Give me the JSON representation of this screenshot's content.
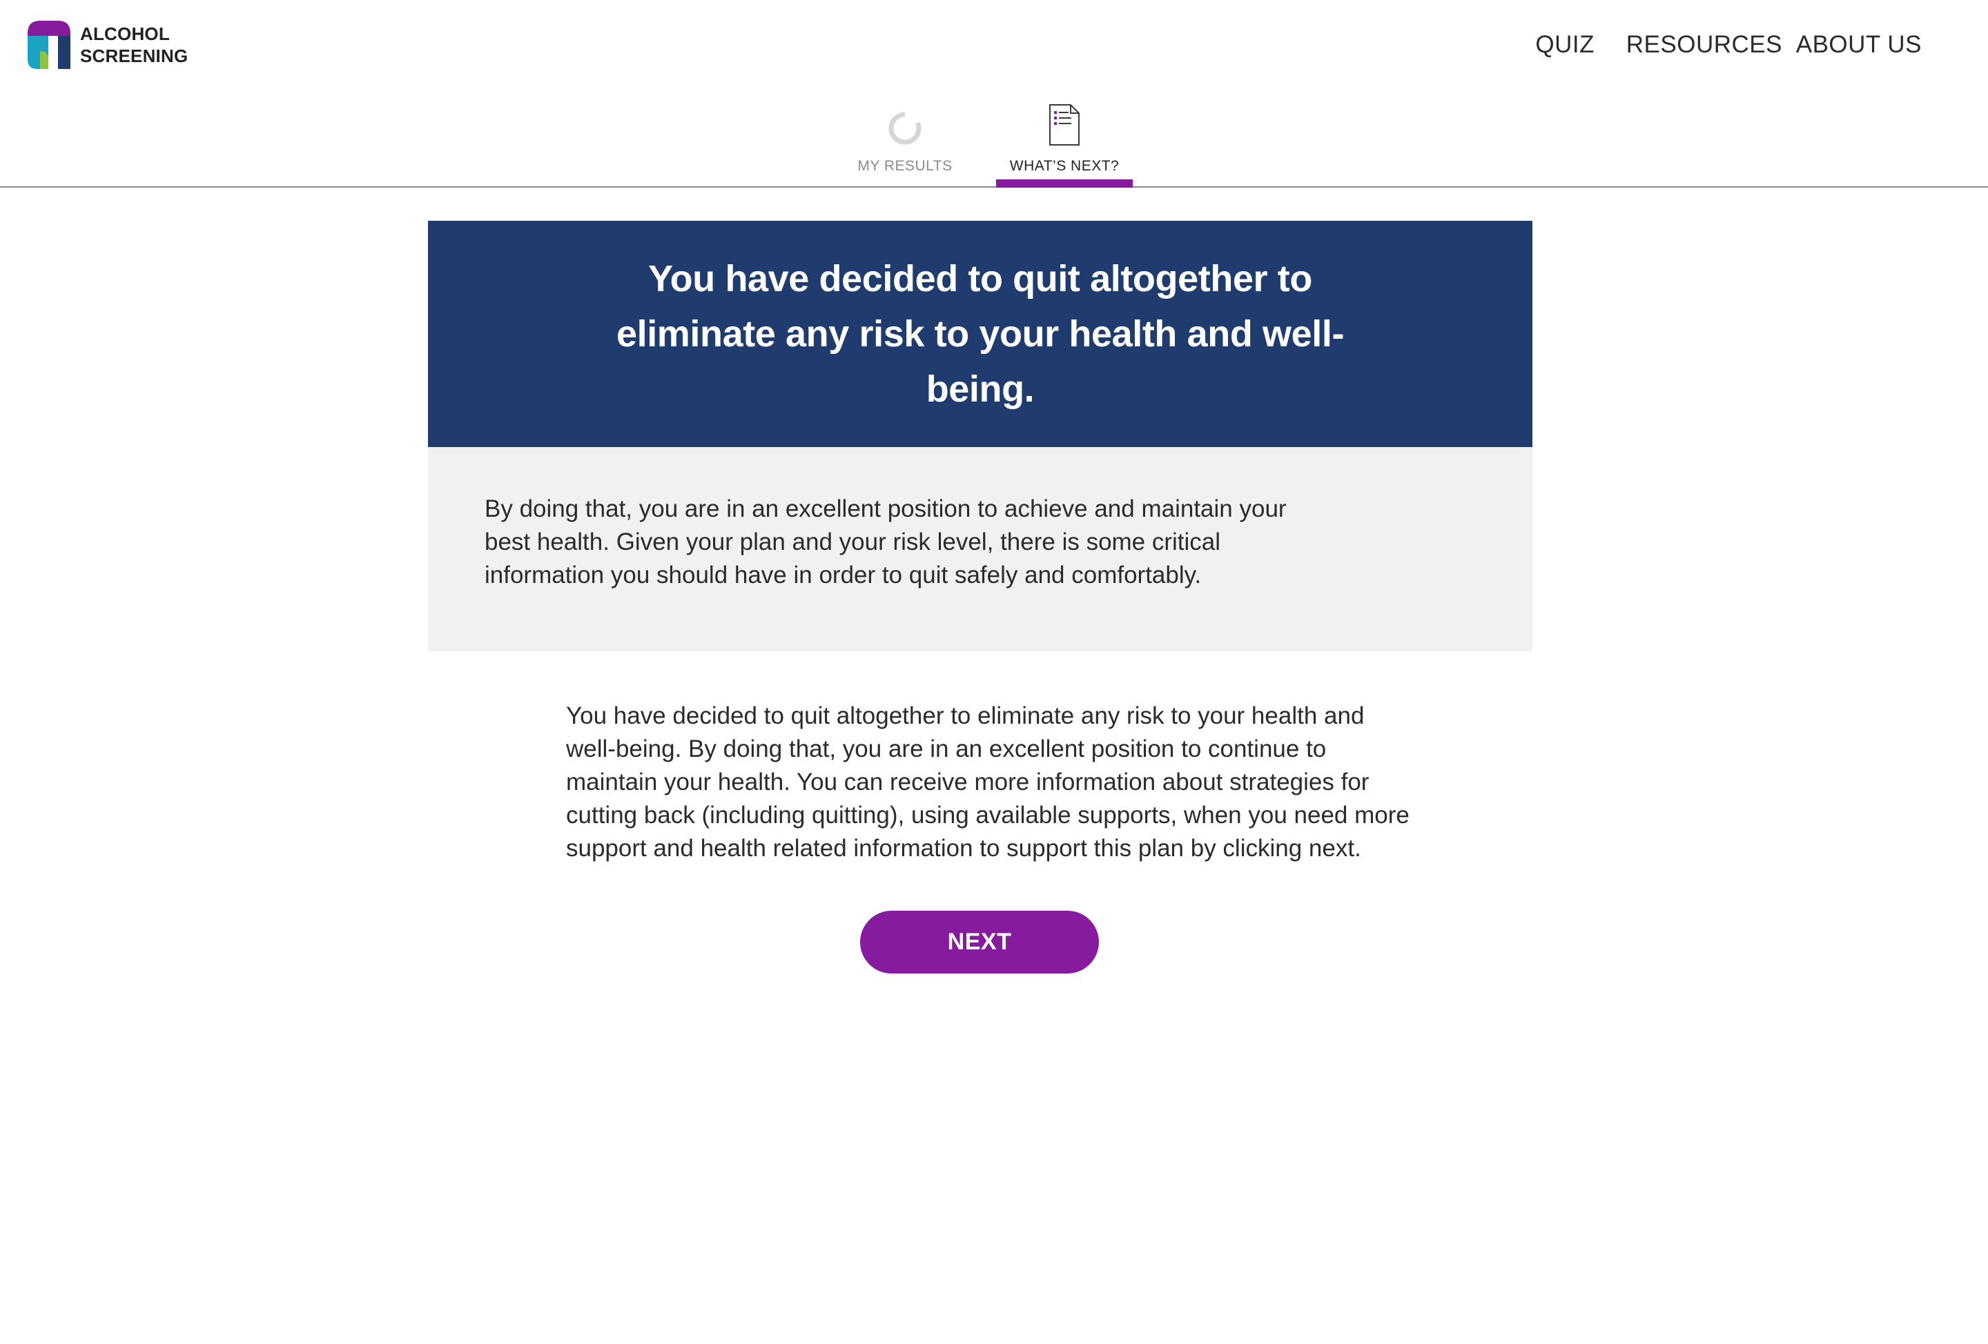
{
  "brand": {
    "line1": "ALCOHOL",
    "line2": "SCREENING",
    "colors": {
      "purple": "#861b9e",
      "teal": "#1aa3c3",
      "green": "#8cc43f",
      "navy": "#203c6e"
    }
  },
  "nav": {
    "items": [
      {
        "label": "QUIZ"
      },
      {
        "label": "RESOURCES"
      },
      {
        "label": "ABOUT US"
      }
    ]
  },
  "tabs": [
    {
      "label": "MY RESULTS",
      "icon": "progress-ring-icon",
      "active": false
    },
    {
      "label": "WHAT’S NEXT?",
      "icon": "document-list-icon",
      "active": true
    }
  ],
  "hero": {
    "title": "You have decided to quit altogether to eliminate any risk to your health and well-being."
  },
  "info": {
    "text": "By doing that, you are in an excellent position to achieve and maintain your best health. Given your plan and your risk level, there is some critical information you should have in order to quit safely and comfortably."
  },
  "body": {
    "text": "You have decided to quit altogether to eliminate any risk to your health and well-being. By doing that, you are in an excellent position to continue to maintain your health. You can receive more information about strategies for cutting back (including quitting), using available supports, when you need more support and health related information to support this plan by clicking next."
  },
  "actions": {
    "next_label": "NEXT"
  },
  "theme": {
    "accent": "#861b9e",
    "hero_bg": "#203c6e",
    "info_bg": "#f1f1ef",
    "text": "#2b2b2b"
  }
}
